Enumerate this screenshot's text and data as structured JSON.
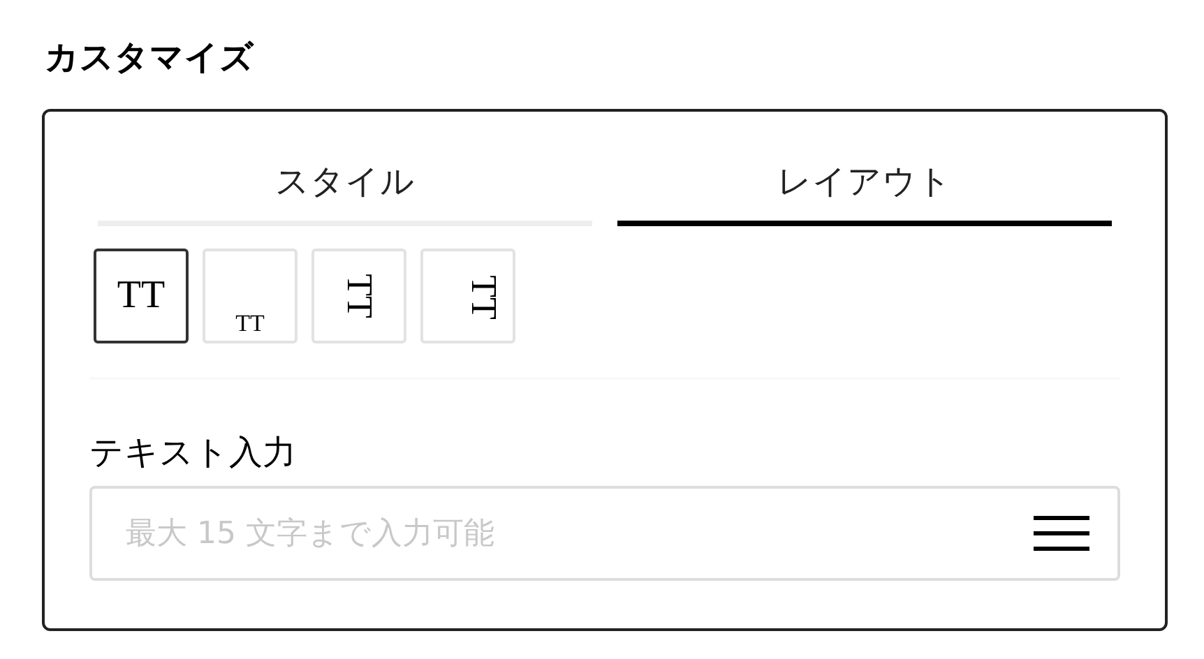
{
  "title": "カスタマイズ",
  "tabs": [
    {
      "label": "スタイル",
      "selected": false
    },
    {
      "label": "レイアウト",
      "selected": true
    }
  ],
  "layout_options": [
    {
      "label": "TT",
      "kind": "center",
      "selected": true
    },
    {
      "label": "TT",
      "kind": "bottom",
      "selected": false
    },
    {
      "label": "TT",
      "kind": "rotated-center",
      "selected": false
    },
    {
      "label": "TT",
      "kind": "rotated-bottom",
      "selected": false
    }
  ],
  "text_input": {
    "label": "テキスト入力",
    "placeholder": "最大 15 文字まで入力可能"
  }
}
